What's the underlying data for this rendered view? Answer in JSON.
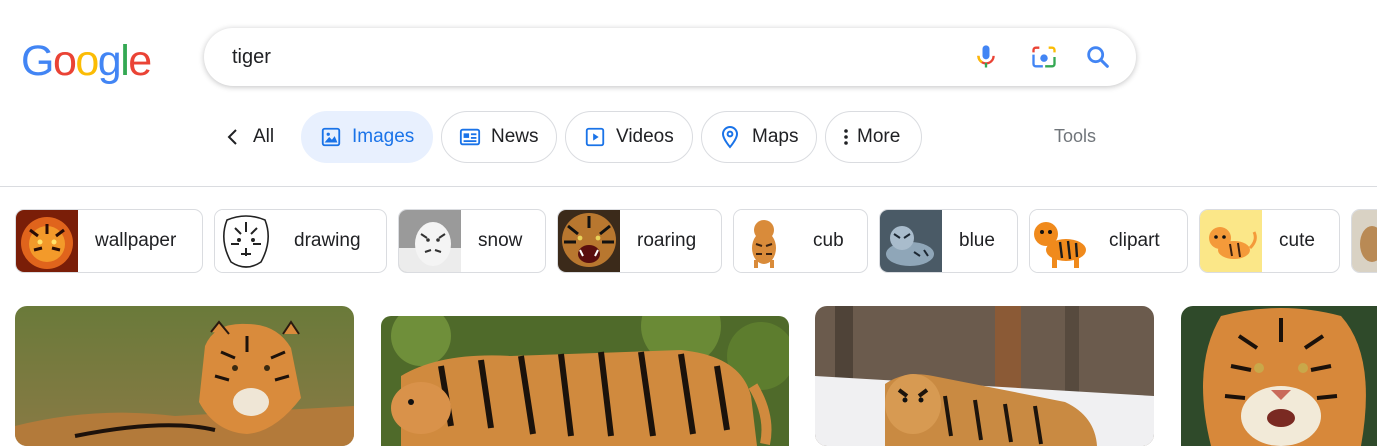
{
  "logo": {
    "letters": [
      "G",
      "o",
      "o",
      "g",
      "l",
      "e"
    ],
    "colors": [
      "#4285F4",
      "#EA4335",
      "#FBBC05",
      "#4285F4",
      "#34A853",
      "#EA4335"
    ]
  },
  "search": {
    "value": "tiger",
    "placeholder": ""
  },
  "icons": {
    "mic": "mic-icon",
    "lens": "lens-camera-icon",
    "search": "search-icon"
  },
  "tabs": [
    {
      "label": "All",
      "icon": "chevron-left-icon"
    },
    {
      "label": "Images",
      "icon": "image-icon",
      "active": true
    },
    {
      "label": "News",
      "icon": "news-icon"
    },
    {
      "label": "Videos",
      "icon": "video-icon"
    },
    {
      "label": "Maps",
      "icon": "map-pin-icon"
    },
    {
      "label": "More",
      "icon": "vertical-dots-icon"
    }
  ],
  "tools_label": "Tools",
  "chips": [
    {
      "label": "wallpaper"
    },
    {
      "label": "drawing"
    },
    {
      "label": "snow"
    },
    {
      "label": "roaring"
    },
    {
      "label": "cub"
    },
    {
      "label": "blue"
    },
    {
      "label": "clipart"
    },
    {
      "label": "cute"
    }
  ],
  "colors": {
    "accent": "#1a73e8",
    "active_tab_bg": "#e8f0fe",
    "border": "#dadce0",
    "muted": "#70757a"
  }
}
